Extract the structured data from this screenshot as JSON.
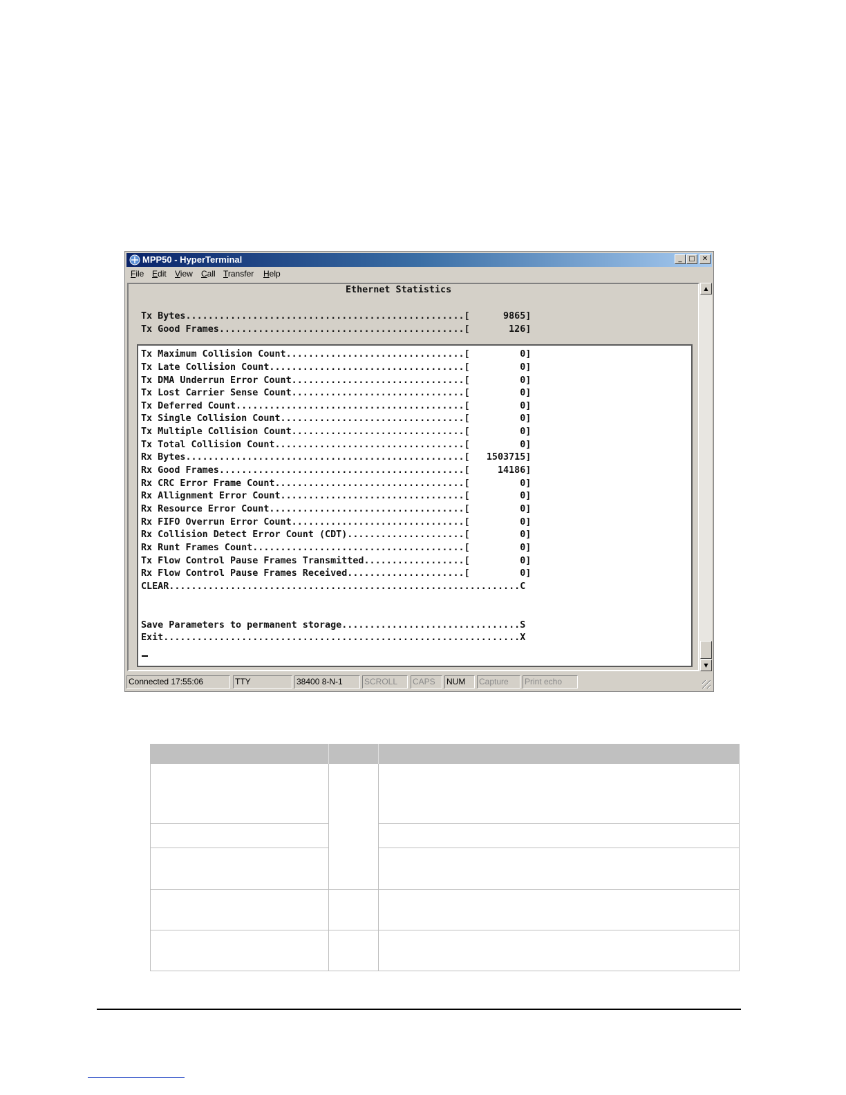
{
  "window": {
    "title": "MPP50 - HyperTerminal",
    "controls": {
      "minimize": "_",
      "maximize": "□",
      "close": "✕"
    }
  },
  "menu": [
    {
      "accel": "F",
      "rest": "ile"
    },
    {
      "accel": "E",
      "rest": "dit"
    },
    {
      "accel": "V",
      "rest": "iew"
    },
    {
      "accel": "C",
      "rest": "all"
    },
    {
      "accel": "T",
      "rest": "ransfer"
    },
    {
      "accel": "H",
      "rest": "elp"
    }
  ],
  "terminal": {
    "heading": "Ethernet Statistics",
    "top_lines": [
      "Tx Bytes..................................................[      9865]",
      "Tx Good Frames............................................[       126]"
    ],
    "box_lines": [
      "Tx Maximum Collision Count................................[         0]",
      "Tx Late Collision Count...................................[         0]",
      "Tx DMA Underrun Error Count...............................[         0]",
      "Tx Lost Carrier Sense Count...............................[         0]",
      "Tx Deferred Count.........................................[         0]",
      "Tx Single Collision Count.................................[         0]",
      "Tx Multiple Collision Count...............................[         0]",
      "Tx Total Collision Count..................................[         0]",
      "Rx Bytes..................................................[   1503715]",
      "Rx Good Frames............................................[     14186]",
      "Rx CRC Error Frame Count..................................[         0]",
      "Rx Allignment Error Count.................................[         0]",
      "Rx Resource Error Count...................................[         0]",
      "Rx FIFO Overrun Error Count...............................[         0]",
      "Rx Collision Detect Error Count (CDT).....................[         0]",
      "Rx Runt Frames Count......................................[         0]",
      "Tx Flow Control Pause Frames Transmitted..................[         0]",
      "Rx Flow Control Pause Frames Received.....................[         0]",
      "CLEAR...............................................................C",
      "",
      "",
      "Save Parameters to permanent storage................................S",
      "Exit................................................................X"
    ]
  },
  "statusbar": [
    "Connected 17:55:06",
    "TTY",
    "38400 8-N-1",
    "SCROLL",
    "CAPS",
    "NUM",
    "Capture",
    "Print echo"
  ]
}
